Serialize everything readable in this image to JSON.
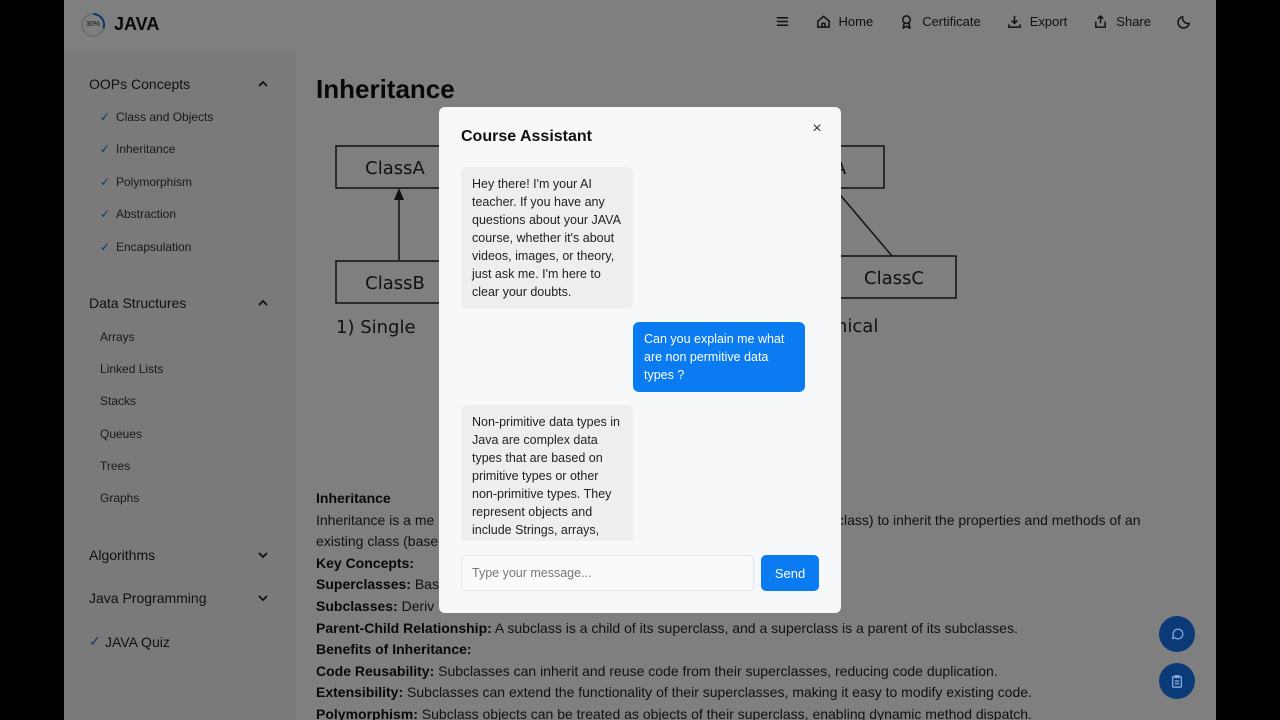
{
  "header": {
    "progress_text": "30%",
    "progress_value": 0.3,
    "brand": "JAVA",
    "nav": [
      {
        "label": "",
        "icon": "menu-icon"
      },
      {
        "label": "Home",
        "icon": "home-icon"
      },
      {
        "label": "Certificate",
        "icon": "certificate-icon"
      },
      {
        "label": "Export",
        "icon": "export-icon"
      },
      {
        "label": "Share",
        "icon": "share-icon"
      },
      {
        "label": "",
        "icon": "moon-icon"
      }
    ]
  },
  "sidebar": {
    "sections": [
      {
        "title": "OOPs Concepts",
        "items": [
          "Class and Objects",
          "Inheritance",
          "Polymorphism",
          "Abstraction",
          "Encapsulation"
        ]
      },
      {
        "title": "Data Structures",
        "items": [
          "Arrays",
          "Linked Lists",
          "Stacks",
          "Queues",
          "Trees",
          "Graphs"
        ]
      },
      {
        "title": "Algorithms"
      },
      {
        "title": "Java Programming"
      },
      {
        "title": "JAVA Quiz"
      }
    ]
  },
  "main": {
    "title": "Inheritance",
    "diagram": {
      "class_a": "ClassA",
      "class_a2": "A",
      "class_b": "ClassB",
      "class_c": "ClassC",
      "caption_single": "1) Single",
      "caption_hier": "hical"
    },
    "content": {
      "heading": "Inheritance",
      "intro_1": "Inheritance is a me",
      "intro_2": "class) to inherit the properties and methods of an",
      "intro_3": "existing class (base",
      "key_concepts": "Key Concepts:",
      "superclasses_label": "Superclasses:",
      "superclasses_text": " Bas",
      "subclasses_label": "Subclasses:",
      "subclasses_text": " Deriv",
      "parent_child_label": "Parent-Child Relationship:",
      "parent_child_text": " A subclass is a child of its superclass, and a superclass is a parent of its subclasses.",
      "benefits": "Benefits of Inheritance:",
      "reuse_label": "Code Reusability:",
      "reuse_text": " Subclasses can inherit and reuse code from their superclasses, reducing code duplication.",
      "ext_label": "Extensibility:",
      "ext_text": " Subclasses can extend the functionality of their superclasses, making it easy to modify existing code.",
      "poly_label": "Polymorphism:",
      "poly_text": " Subclass objects can be treated as objects of their superclass, enabling dynamic method dispatch."
    }
  },
  "modal": {
    "title": "Course Assistant",
    "close": "×",
    "messages": [
      {
        "role": "bot",
        "text": "Hey there! I'm your AI teacher. If you have any questions about your JAVA course, whether it's about videos, images, or theory, just ask me. I'm here to clear your doubts."
      },
      {
        "role": "user",
        "text": "Can you explain me what are non permitive data types ?"
      },
      {
        "role": "bot",
        "text": "Non-primitive data types in Java are complex data types that are based on primitive types or other non-primitive types. They represent objects and include Strings, arrays,"
      }
    ],
    "input_placeholder": "Type your message...",
    "send_label": "Send"
  },
  "fabs": {
    "chat_icon": "chat-icon",
    "notes_icon": "clipboard-icon"
  },
  "colors": {
    "accent": "#0b7bf2",
    "check": "#1f6fd6",
    "fab": "#0a3a78"
  }
}
